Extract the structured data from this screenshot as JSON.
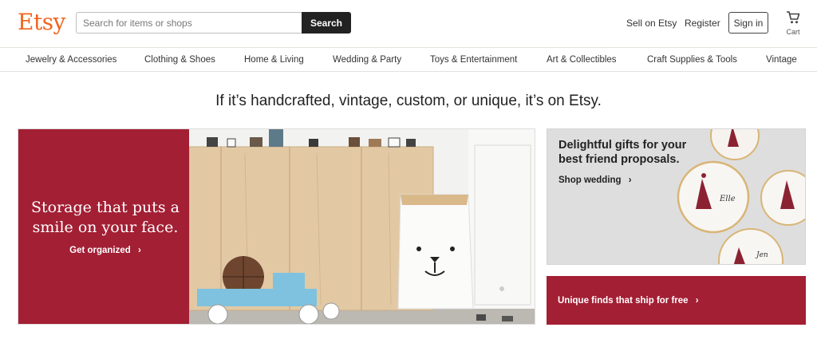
{
  "header": {
    "logo": "Etsy",
    "search_placeholder": "Search for items or shops",
    "search_button": "Search",
    "sell_link": "Sell on Etsy",
    "register_link": "Register",
    "signin_button": "Sign in",
    "cart_label": "Cart"
  },
  "categories": [
    "Jewelry & Accessories",
    "Clothing & Shoes",
    "Home & Living",
    "Wedding & Party",
    "Toys & Entertainment",
    "Art & Collectibles",
    "Craft Supplies & Tools",
    "Vintage"
  ],
  "tagline": "If it’s handcrafted, vintage, custom, or unique, it’s on Etsy.",
  "hero": {
    "title": "Storage that puts a smile on your face.",
    "cta": "Get organized",
    "cta_icon": "chevron-right-icon"
  },
  "gift_banner": {
    "title": "Delightful gifts for your best friend proposals.",
    "cta": "Shop wedding",
    "plate_names": [
      "Elle",
      "Jen"
    ]
  },
  "freeship_banner": {
    "label": "Unique finds that ship for free"
  },
  "colors": {
    "brand": "#F1641E",
    "banner_red": "#A31F34",
    "search_button": "#222222"
  },
  "icons": {
    "cart": "cart-icon",
    "chevron": "chevron-right-icon"
  }
}
